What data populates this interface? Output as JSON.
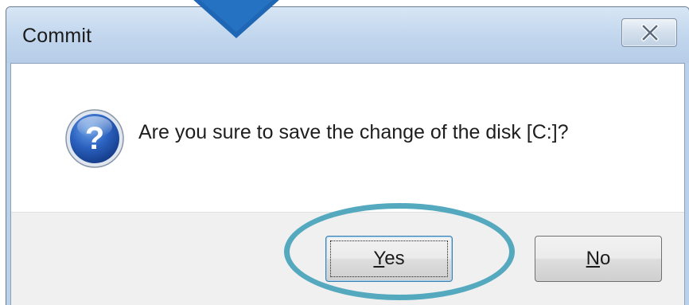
{
  "dialog": {
    "title": "Commit",
    "message": "Are you sure to save the change of the disk [C:]?",
    "icon": "question-icon",
    "close_icon": "close-icon"
  },
  "buttons": {
    "yes": {
      "mnemonic": "Y",
      "rest": "es"
    },
    "no": {
      "mnemonic": "N",
      "rest": "o"
    }
  },
  "annotations": {
    "arrow": "down-arrow-pointer",
    "ring": "highlight-ring",
    "ring_color": "#55a9bf",
    "arrow_color": "#1f66b5"
  },
  "colors": {
    "titlebar": "#c4d8ee",
    "button_strip": "#f0f0f0",
    "focus_border": "#3c7fb1"
  }
}
